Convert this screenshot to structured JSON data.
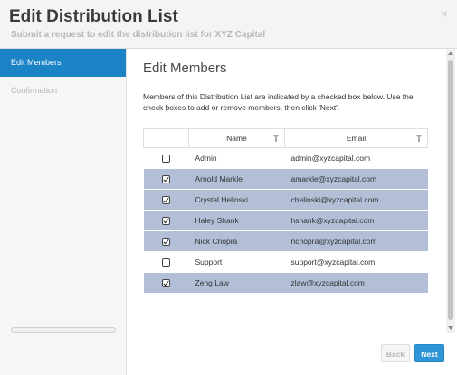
{
  "header": {
    "title": "Edit Distribution List",
    "subtitle": "Submit a request to edit the distribution list for XYZ Capital",
    "close_label": "×"
  },
  "sidebar": {
    "steps": [
      {
        "label": "Edit Members",
        "active": true
      },
      {
        "label": "Confirmation",
        "active": false
      }
    ]
  },
  "main": {
    "title": "Edit Members",
    "instructions": "Members of this Distribution List are indicated by a checked box below. Use the check boxes to add or remove members, then click 'Next'."
  },
  "table": {
    "columns": [
      "Name",
      "Email"
    ],
    "rows": [
      {
        "name": "Admin",
        "email": "admin@xyzcapital.com",
        "checked": false
      },
      {
        "name": "Arnold Markle",
        "email": "amarkle@xyzcapital.com",
        "checked": true
      },
      {
        "name": "Crystal Helinski",
        "email": "chelinski@xyzcapital.com",
        "checked": true
      },
      {
        "name": "Haley Shank",
        "email": "hshank@xyzcapital.com",
        "checked": true
      },
      {
        "name": "Nick Chopra",
        "email": "nchopra@xyzcapital.com",
        "checked": true
      },
      {
        "name": "Support",
        "email": "support@xyzcapital.com",
        "checked": false
      },
      {
        "name": "Zeng Law",
        "email": "zlaw@xyzcapital.com",
        "checked": true
      }
    ]
  },
  "buttons": {
    "back": "Back",
    "next": "Next"
  },
  "colors": {
    "accent": "#1a84c7",
    "selected_row": "#b2bfd7",
    "next_button": "#2f95d6"
  }
}
